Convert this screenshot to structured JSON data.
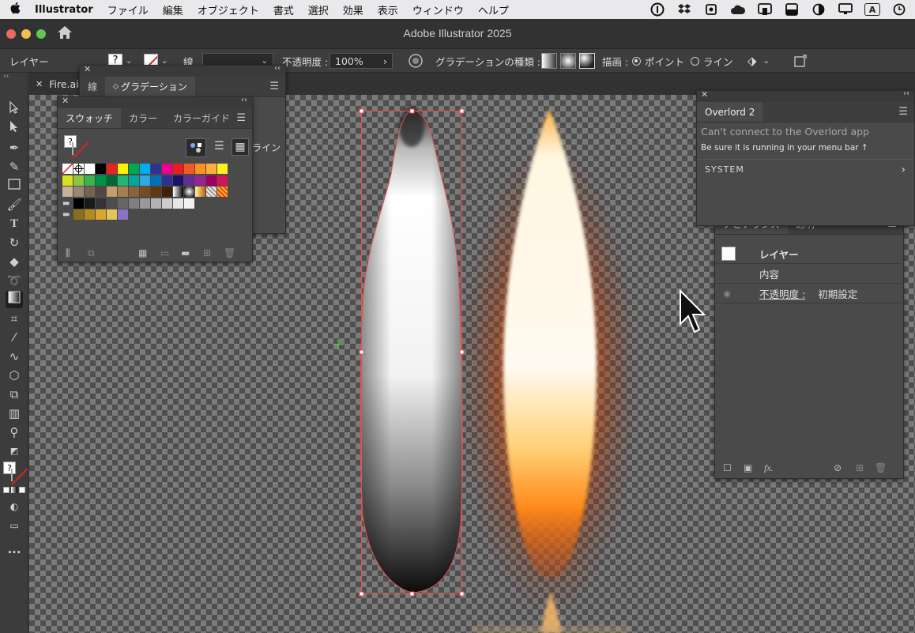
{
  "menubar": {
    "app": "Illustrator",
    "items": [
      "ファイル",
      "編集",
      "オブジェクト",
      "書式",
      "選択",
      "効果",
      "表示",
      "ウィンドウ",
      "ヘルプ"
    ],
    "tray_letter": "A"
  },
  "window": {
    "title": "Adobe Illustrator 2025"
  },
  "controlbar": {
    "selection_label": "レイヤー",
    "stroke_label": "線",
    "opacity_label": "不透明度 :",
    "opacity_value": "100%",
    "gradient_type_label": "グラデーションの種類 :",
    "draw_label": "描画 :",
    "draw_point": "ポイント",
    "draw_line": "ライン"
  },
  "document": {
    "tab": "Fire.ai*"
  },
  "gradient_panel": {
    "tabs": [
      "線",
      "グラデーション"
    ],
    "partial_text": "ライン"
  },
  "swatches_panel": {
    "tabs": [
      "スウォッチ",
      "カラー",
      "カラーガイド"
    ],
    "rows": [
      [
        "none",
        "reg",
        "#ffffff",
        "#000000",
        "#e8231f",
        "#ffef00",
        "#00a650",
        "#00aeef",
        "#2e3192",
        "#ec008c",
        "#ed1c24",
        "#f15a24",
        "#f7931e",
        "#fbb03b",
        "#fcee21"
      ],
      [
        "#d9e021",
        "#8cc63f",
        "#39b54a",
        "#009245",
        "#006837",
        "#22b573",
        "#00a99d",
        "#29abe2",
        "#0071bc",
        "#2e3192",
        "#1b1464",
        "#662d91",
        "#93278f",
        "#9e005d",
        "#d4145a"
      ],
      [
        "#c7b299",
        "#998675",
        "#736357",
        "#534741",
        "#c69c6d",
        "#a67c52",
        "#8c6239",
        "#754c24",
        "#603813",
        "#42210b",
        "grad-bw",
        "grad-radial",
        "grad-orange",
        "pattern1",
        "pattern2"
      ],
      [
        "folder",
        "#000000",
        "#1a1a1a",
        "#333333",
        "#4d4d4d",
        "#666666",
        "#808080",
        "#999999",
        "#b3b3b3",
        "#cccccc",
        "#e6e6e6",
        "#f2f2f2"
      ],
      [
        "folder",
        "#8c6d1f",
        "#b38b1f",
        "#d9a62e",
        "#e6c45c",
        "#8a72c9"
      ]
    ]
  },
  "overlord_panel": {
    "tab": "Overlord 2",
    "message": "Can't connect to the Overlord app",
    "hint": "Be sure it is running in your menu bar ↑",
    "section": "SYSTEM"
  },
  "appearance_panel": {
    "tabs": [
      "アピアランス",
      "透明"
    ],
    "rows": [
      {
        "label": "レイヤー",
        "value": ""
      },
      {
        "label": "内容",
        "value": ""
      },
      {
        "label": "不透明度 :",
        "value": "初期設定"
      }
    ]
  },
  "icons": {
    "apple": "apple-icon",
    "home": "home-icon",
    "cursor": "arrow-cursor-icon"
  }
}
